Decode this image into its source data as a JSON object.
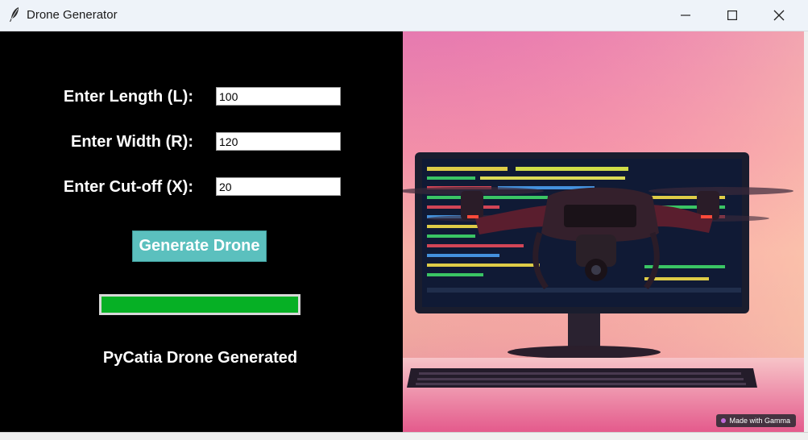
{
  "window": {
    "title": "Drone Generator",
    "icon": "feather-icon"
  },
  "controls": {
    "minimize": "minimize-icon",
    "maximize": "maximize-icon",
    "close": "close-icon"
  },
  "form": {
    "length": {
      "label": "Enter Length (L):",
      "value": "100"
    },
    "width": {
      "label": "Enter Width (R):",
      "value": "120"
    },
    "cutoff": {
      "label": "Enter Cut-off (X):",
      "value": "20"
    }
  },
  "generate_button": {
    "label": "Generate Drone",
    "color": "#5bc0be"
  },
  "progress": {
    "percent": 100,
    "color": "#06b025"
  },
  "status": {
    "text": "PyCatia Drone Generated"
  },
  "image": {
    "badge": "Made with Gamma"
  }
}
